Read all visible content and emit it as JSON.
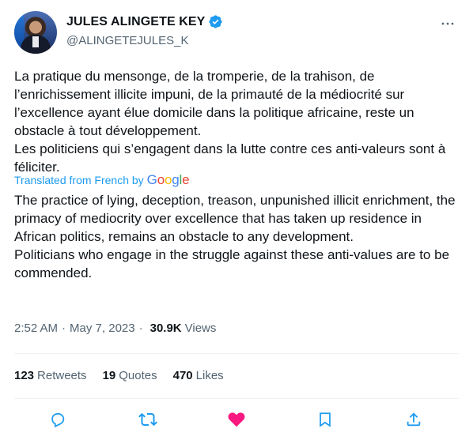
{
  "author": {
    "name": "JULES ALINGETE KEY",
    "handle": "@ALINGETEJULES_K",
    "verified": true
  },
  "tweet": {
    "original_text": "La pratique du mensonge, de la tromperie, de la trahison, de l’enrichissement illicite impuni, de la primauté de la médiocrité sur l’excellence ayant élue domicile dans la politique africaine, reste un obstacle à tout développement.\nLes politiciens qui s’engagent dans la lutte contre ces anti-valeurs sont à féliciter.",
    "translated_label": "Translated from French by",
    "translator_logo": "Google",
    "translated_text": "The practice of lying, deception, treason, unpunished illicit enrichment, the primacy of mediocrity over excellence that has taken up residence in African politics, remains an obstacle to any development.\nPoliticians who engage in the struggle against these anti-values are to be commended."
  },
  "meta": {
    "time": "2:52 AM",
    "separator": "·",
    "date": "May 7, 2023",
    "views_count": "30.9K",
    "views_label": "Views"
  },
  "stats": {
    "retweets_count": "123",
    "retweets_label": "Retweets",
    "quotes_count": "19",
    "quotes_label": "Quotes",
    "likes_count": "470",
    "likes_label": "Likes"
  },
  "actions": [
    "reply-icon",
    "retweet-icon",
    "like-icon",
    "bookmark-icon",
    "share-icon"
  ],
  "colors": {
    "accent": "#1d9bf0",
    "like": "#f91880",
    "text": "#0f1419",
    "secondary": "#536471"
  }
}
